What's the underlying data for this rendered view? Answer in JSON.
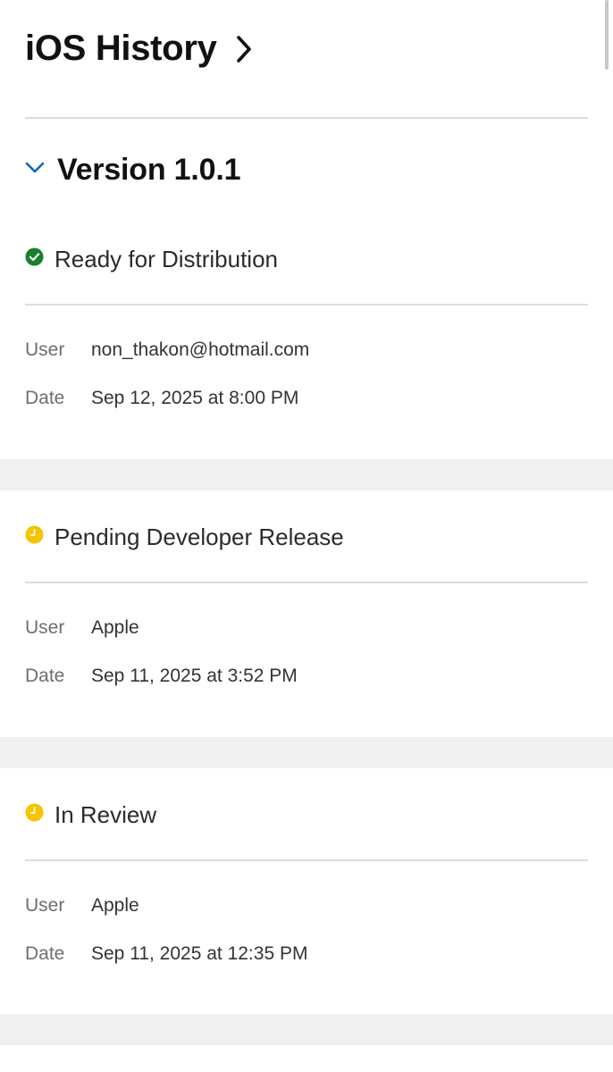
{
  "header": {
    "title": "iOS History"
  },
  "version": {
    "title": "Version 1.0.1"
  },
  "entries": [
    {
      "status": "Ready for Distribution",
      "status_icon": "check-circle-icon",
      "status_color": "#1a7f2e",
      "user_label": "User",
      "user": "non_thakon@hotmail.com",
      "date_label": "Date",
      "date": "Sep 12, 2025 at 8:00 PM"
    },
    {
      "status": "Pending Developer Release",
      "status_icon": "clock-icon",
      "status_color": "#f5c400",
      "user_label": "User",
      "user": "Apple",
      "date_label": "Date",
      "date": "Sep 11, 2025 at 3:52 PM"
    },
    {
      "status": "In Review",
      "status_icon": "clock-icon",
      "status_color": "#f5c400",
      "user_label": "User",
      "user": "Apple",
      "date_label": "Date",
      "date": "Sep 11, 2025 at 12:35 PM"
    }
  ],
  "colors": {
    "accent": "#0a66c2",
    "divider": "#dcdcdc",
    "band": "#f0f0f0"
  }
}
